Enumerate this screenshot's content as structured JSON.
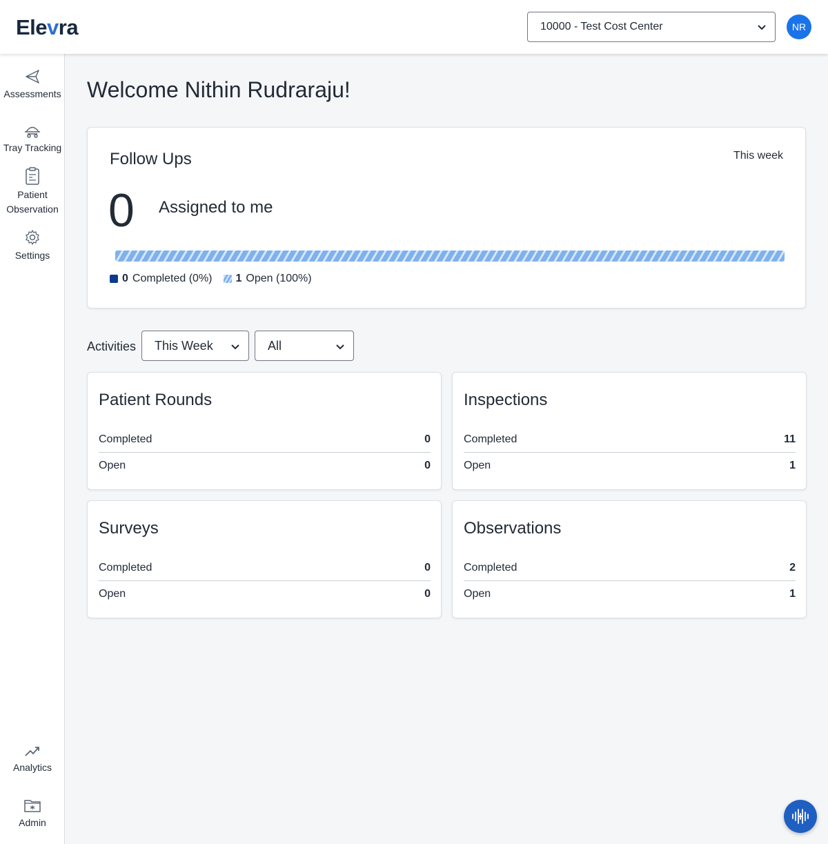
{
  "brand": {
    "logo_prefix": "Ele",
    "logo_accent": "v",
    "logo_suffix": "ra",
    "accent_color": "#2c6fd1"
  },
  "header": {
    "cost_center": "10000 - Test Cost Center",
    "avatar_initials": "NR"
  },
  "sidebar": {
    "items": [
      {
        "label": "Assessments",
        "icon": "send-icon"
      },
      {
        "label": "Tray Tracking",
        "icon": "tray-cart-icon"
      },
      {
        "label": "Patient Observation",
        "icon": "clipboard-icon"
      },
      {
        "label": "Settings",
        "icon": "gear-icon"
      }
    ],
    "bottom_items": [
      {
        "label": "Analytics",
        "icon": "trend-icon"
      },
      {
        "label": "Admin",
        "icon": "admin-folder-icon"
      }
    ]
  },
  "welcome": "Welcome Nithin Rudraraju!",
  "follow_ups": {
    "title": "Follow Ups",
    "period": "This week",
    "count": "0",
    "assigned_label": "Assigned to me",
    "open_fraction": 1.0,
    "legend": {
      "completed_count": "0",
      "completed_label": "Completed (0%)",
      "open_count": "1",
      "open_label": "Open (100%)"
    }
  },
  "activities": {
    "label": "Activities",
    "period_filter": "This Week",
    "type_filter": "All",
    "cards": [
      {
        "title": "Patient Rounds",
        "completed_label": "Completed",
        "completed": "0",
        "open_label": "Open",
        "open": "0"
      },
      {
        "title": "Inspections",
        "completed_label": "Completed",
        "completed": "11",
        "open_label": "Open",
        "open": "1"
      },
      {
        "title": "Surveys",
        "completed_label": "Completed",
        "completed": "0",
        "open_label": "Open",
        "open": "0"
      },
      {
        "title": "Observations",
        "completed_label": "Completed",
        "completed": "2",
        "open_label": "Open",
        "open": "1"
      }
    ]
  },
  "chat": {
    "icon": "voice-assistant-icon"
  }
}
